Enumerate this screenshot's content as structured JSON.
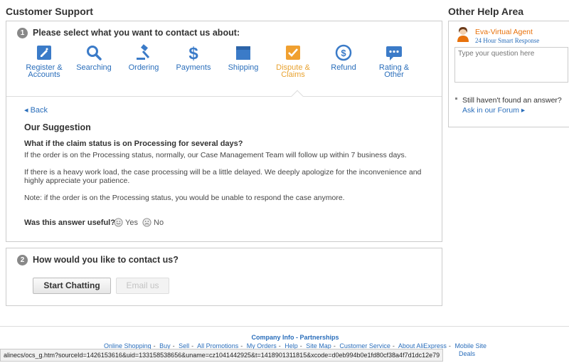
{
  "left_title": "Customer Support",
  "right_title": "Other Help Area",
  "step1": {
    "num": "1",
    "title": "Please select what you want to contact us about:"
  },
  "categories": [
    {
      "label1": "Register &",
      "label2": "Accounts",
      "icon": "register-icon"
    },
    {
      "label1": "Searching",
      "label2": "",
      "icon": "search-icon"
    },
    {
      "label1": "Ordering",
      "label2": "",
      "icon": "gavel-icon"
    },
    {
      "label1": "Payments",
      "label2": "",
      "icon": "dollar-icon"
    },
    {
      "label1": "Shipping",
      "label2": "",
      "icon": "box-icon"
    },
    {
      "label1": "Dispute &",
      "label2": "Claims",
      "icon": "dispute-icon",
      "active": true
    },
    {
      "label1": "Refund",
      "label2": "",
      "icon": "refund-icon"
    },
    {
      "label1": "Rating &",
      "label2": "Other",
      "icon": "chat-icon"
    }
  ],
  "back_label": "Back",
  "suggestion_title": "Our Suggestion",
  "question": "What if the claim status is on Processing for several days?",
  "paragraphs": [
    "If the order is on the Processing status, normally, our Case Management Team will follow up within 7 business days.",
    "If there is a heavy work load, the case processing will be a little delayed. We deeply apologize for the inconvenience and highly appreciate your patience.",
    "Note: if the order is on the Processing status, you would be unable to respond the case anymore."
  ],
  "useful_label": "Was this answer useful?",
  "yes_label": "Yes",
  "no_label": "No",
  "step2": {
    "num": "2",
    "title": "How would you like to contact us?"
  },
  "start_chatting": "Start Chatting",
  "email_us": "Email us",
  "agent": {
    "name": "Eva-Virtual Agent",
    "sub": "24 Hour Smart Response",
    "placeholder": "Type your question here"
  },
  "not_found": "Still haven't found an answer?",
  "forum": "Ask in our Forum",
  "footer": {
    "company": "Company Info - Partnerships",
    "links": [
      "Online Shopping",
      "Buy",
      "Sell",
      "All Promotions",
      "My Orders",
      "Help",
      "Site Map",
      "Customer Service",
      "About AliExpress",
      "Mobile Site"
    ],
    "deals": "Deals"
  },
  "status_url": "alinecs/ocs_g.htm?sourceId=1426153616&uid=133158538656&uname=cz1041442925&t=1418901311815&xcode=d0eb994b0e1fd80cf38a4f7d1dc12e79",
  "colors": {
    "link": "#2a6ebb",
    "active": "#e8a230",
    "agent": "#e8720c"
  }
}
